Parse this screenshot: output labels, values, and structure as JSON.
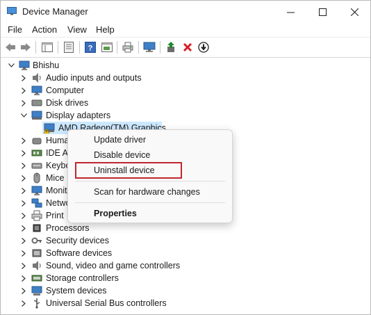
{
  "window": {
    "title": "Device Manager"
  },
  "menu": [
    "File",
    "Action",
    "View",
    "Help"
  ],
  "tree": {
    "root": "Bhishu",
    "categories": [
      "Audio inputs and outputs",
      "Computer",
      "Disk drives",
      "Display adapters",
      "Huma",
      "IDE AT",
      "Keybo",
      "Mice",
      "Monit",
      "Netwo",
      "Print",
      "Processors",
      "Security devices",
      "Software devices",
      "Sound, video and game controllers",
      "Storage controllers",
      "System devices",
      "Universal Serial Bus controllers"
    ],
    "selected_device": "AMD Radeon(TM) Graphics"
  },
  "context_menu": {
    "items": [
      "Update driver",
      "Disable device",
      "Uninstall device",
      "Scan for hardware changes",
      "Properties"
    ]
  },
  "colors": {
    "selection": "#cce8ff",
    "highlight": "#c0272d",
    "remove": "#d61f26",
    "enable": "#1c8a2e"
  }
}
